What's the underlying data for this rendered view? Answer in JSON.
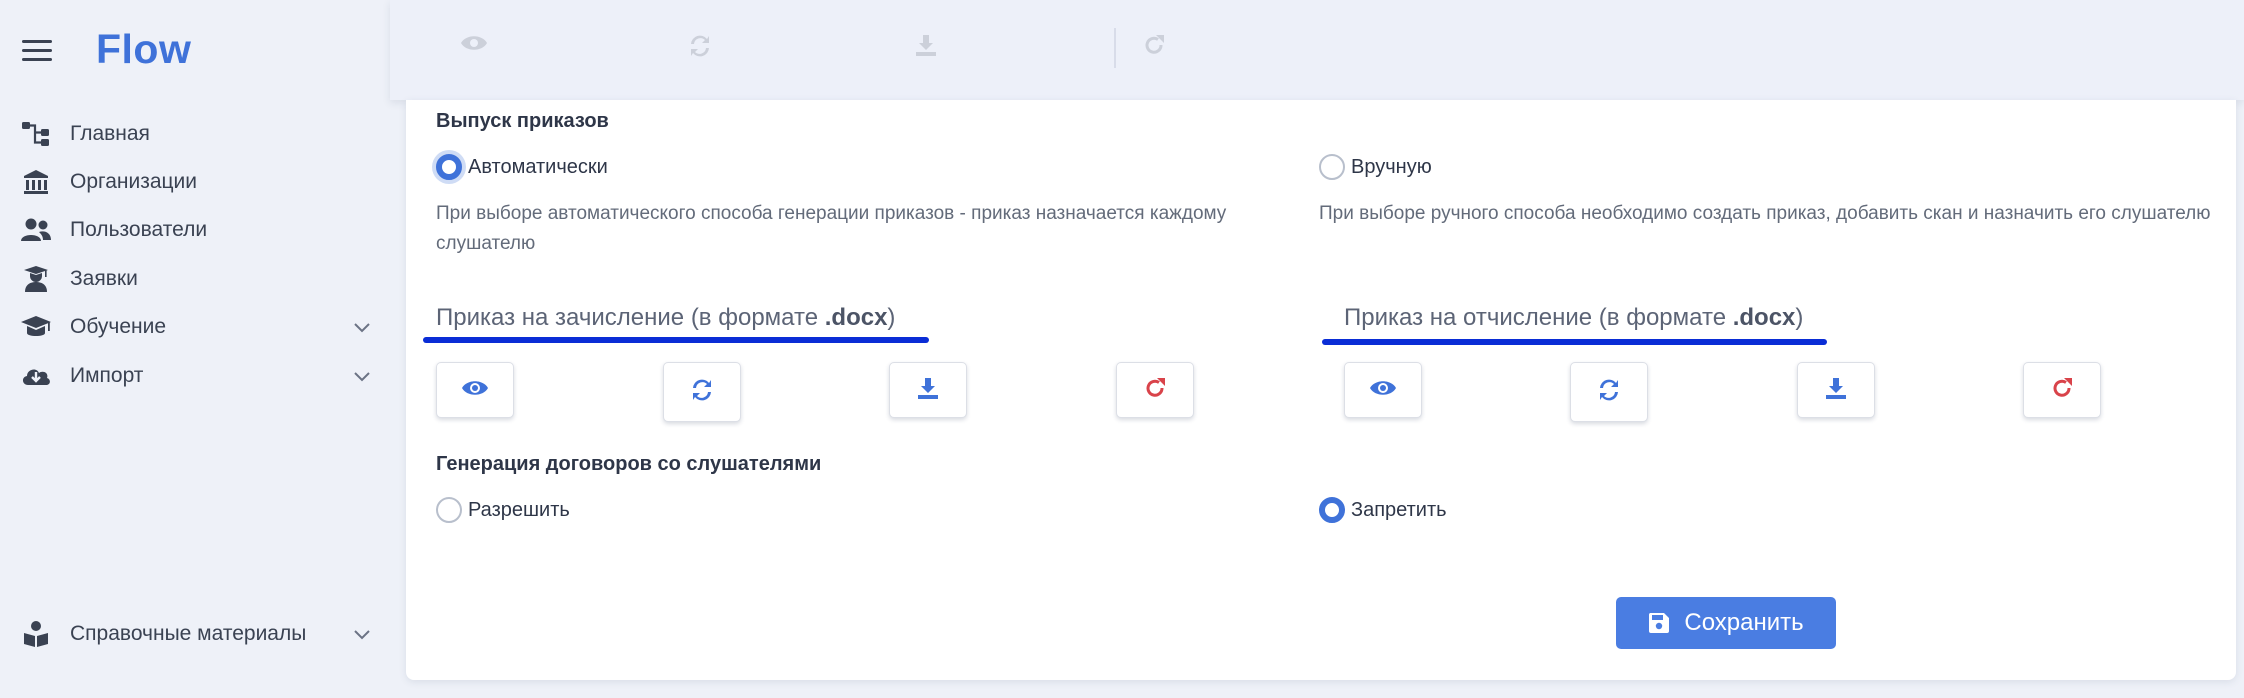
{
  "app": {
    "logo": "Flow"
  },
  "sidebar": {
    "items": [
      {
        "label": "Главная",
        "icon": "sitemap-icon"
      },
      {
        "label": "Организации",
        "icon": "institution-icon"
      },
      {
        "label": "Пользователи",
        "icon": "users-icon"
      },
      {
        "label": "Заявки",
        "icon": "user-graduate-icon"
      },
      {
        "label": "Обучение",
        "icon": "graduation-cap-icon",
        "expandable": true
      },
      {
        "label": "Импорт",
        "icon": "cloud-download-icon",
        "expandable": true
      }
    ],
    "bottom_item": {
      "label": "Справочные материалы",
      "icon": "book-reader-icon",
      "expandable": true
    }
  },
  "orders": {
    "title": "Выпуск приказов",
    "auto": {
      "label": "Автоматически",
      "checked": true,
      "description": "При выборе автоматического способа генерации приказов - приказ назначается каждому слушателю"
    },
    "manual": {
      "label": "Вручную",
      "checked": false,
      "description": "При выборе ручного способа необходимо создать приказ, добавить скан и назначить его слушателю"
    },
    "enroll": {
      "title_prefix": "Приказ на зачисление (в формате ",
      "format": ".docx",
      "title_suffix": ")"
    },
    "expel": {
      "title_prefix": "Приказ на отчисление (в формате ",
      "format": ".docx",
      "title_suffix": ")"
    },
    "actions": [
      "view",
      "regenerate",
      "download",
      "reset"
    ]
  },
  "contracts": {
    "title": "Генерация договоров со слушателями",
    "allow": {
      "label": "Разрешить",
      "checked": false
    },
    "deny": {
      "label": "Запретить",
      "checked": true
    }
  },
  "save": {
    "label": "Сохранить"
  },
  "colors": {
    "accent": "#3f72d9",
    "danger": "#d9434a",
    "underline": "#0a2dd6",
    "background": "#eef1f8"
  }
}
